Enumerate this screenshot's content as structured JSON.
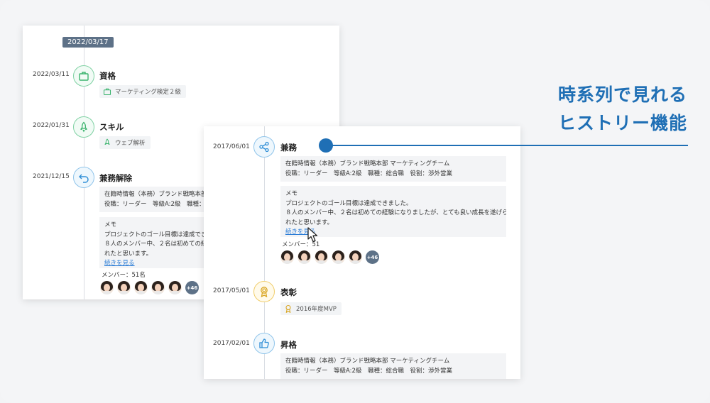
{
  "back": {
    "date_chip": "2022/03/17",
    "events": [
      {
        "date": "2022/03/11",
        "title": "資格",
        "tag": "マーケティング検定２級"
      },
      {
        "date": "2022/01/31",
        "title": "スキル",
        "tag": "ウェブ解析"
      },
      {
        "date": "2021/12/15",
        "title": "兼務解除",
        "affiliation_line1": "在籍時情報（本務）ブランド戦略本部",
        "affiliation_line2": "役職：リーダー　等級A:2級　職種：",
        "memo_label": "メモ",
        "memo_line1": "プロジェクトのゴール目標は達成でき",
        "memo_line2": "８人のメンバー中、２名は初めての経",
        "memo_line3": "れたと思います。",
        "more_link": "続きを見る",
        "members": "メンバー：51名",
        "more_count": "+46"
      }
    ]
  },
  "front": {
    "events": [
      {
        "date": "2017/06/01",
        "title": "兼務",
        "affiliation_line1": "在籍時情報（本務）ブランド戦略本部 マーケティングチーム",
        "affiliation_line2": "役職：リーダー　等級A:2級　職種：総合職　役割：渉外営業",
        "memo_label": "メモ",
        "memo_line1": "プロジェクトのゴール目標は達成できました。",
        "memo_line2": "８人のメンバー中、２名は初めての経験になりましたが、とても良い成長を遂げら",
        "memo_line3": "れたと思います。",
        "more_link": "続きを見る",
        "members": "メンバー：51",
        "more_count": "+46"
      },
      {
        "date": "2017/05/01",
        "title": "表彰",
        "tag": "2016年度MVP"
      },
      {
        "date": "2017/02/01",
        "title": "昇格",
        "affiliation_line1": "在籍時情報（本務）ブランド戦略本部 マーケティングチーム",
        "affiliation_line2": "役職：リーダー　等級A:2級　職種：総合職　役割：渉外営業"
      }
    ]
  },
  "headline": {
    "line1": "時系列で見れる",
    "line2": "ヒストリー機能"
  },
  "colors": {
    "accent": "#1f6fb5",
    "chip": "#5d7187",
    "green": "#7fd1a3",
    "blue": "#8fc4ea",
    "gold": "#f0cd6a"
  }
}
